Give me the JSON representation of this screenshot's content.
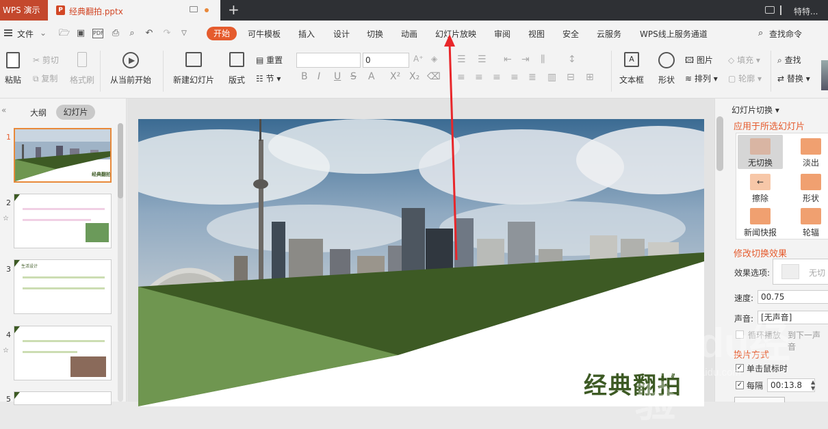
{
  "titlebar": {
    "app_name": "WPS 演示",
    "doc_tab": "经典翻拍.pptx",
    "doc_badge": "P",
    "add_tab": "+",
    "user": "特特..."
  },
  "menubar": {
    "file": "文件",
    "tabs": [
      "开始",
      "可牛模板",
      "插入",
      "设计",
      "切换",
      "动画",
      "幻灯片放映",
      "审阅",
      "视图",
      "安全",
      "云服务",
      "WPS线上服务通道"
    ],
    "search": "查找命令"
  },
  "ribbon": {
    "paste": "粘贴",
    "cut": "剪切",
    "copy": "复制",
    "format_painter": "格式刷",
    "play_from_current": "从当前开始",
    "new_slide": "新建幻灯片",
    "layout": "版式",
    "reset": "重置",
    "section": "节",
    "font_size": "0",
    "textbox": "文本框",
    "shape": "形状",
    "picture": "图片",
    "fill": "填充",
    "arrange": "排列",
    "outline": "轮廓",
    "find": "查找",
    "replace": "替换"
  },
  "leftpanel": {
    "tab_outline": "大纲",
    "tab_slides": "幻灯片",
    "collapse": "«",
    "thumb_title": "经典翻拍",
    "slides": [
      {
        "num": "1",
        "star": ""
      },
      {
        "num": "2",
        "star": "☆"
      },
      {
        "num": "3",
        "star": ""
      },
      {
        "num": "4",
        "star": "☆"
      },
      {
        "num": "5",
        "star": ""
      }
    ],
    "slide3_heading": "生活设计"
  },
  "slide": {
    "title": "经典翻拍"
  },
  "rightpanel": {
    "header": "幻灯片切换",
    "apply_section": "应用于所选幻灯片",
    "transitions": [
      {
        "label": "无切换",
        "color": "#d9b5a3"
      },
      {
        "label": "淡出",
        "color": "#f0a070"
      },
      {
        "label": "擦除",
        "color": "#f0a070"
      },
      {
        "label": "形状",
        "color": "#f0a070"
      },
      {
        "label": "新闻快报",
        "color": "#f0a070"
      },
      {
        "label": "轮辐",
        "color": "#f0a070"
      }
    ],
    "modify_section": "修改切换效果",
    "effect_label": "效果选项:",
    "effect_value": "无切",
    "speed_label": "速度:",
    "speed_value": "00.75",
    "sound_label": "声音:",
    "sound_value": "[无声音]",
    "loop_label": "循环播放",
    "until_next": "到下一声音",
    "advance_label": "换片方式",
    "on_click": "单击鼠标时",
    "every": "每隔",
    "every_value": "00:13.8"
  },
  "watermark": {
    "brand": "Baidu经验",
    "url": "jingyan.baidu.com"
  },
  "colors": {
    "accent": "#e55b2d",
    "titlebar": "#2e3034",
    "slide_green_dark": "#3d5a24",
    "slide_green_light": "#6f9650",
    "annotation_arrow": "#e8262a"
  }
}
